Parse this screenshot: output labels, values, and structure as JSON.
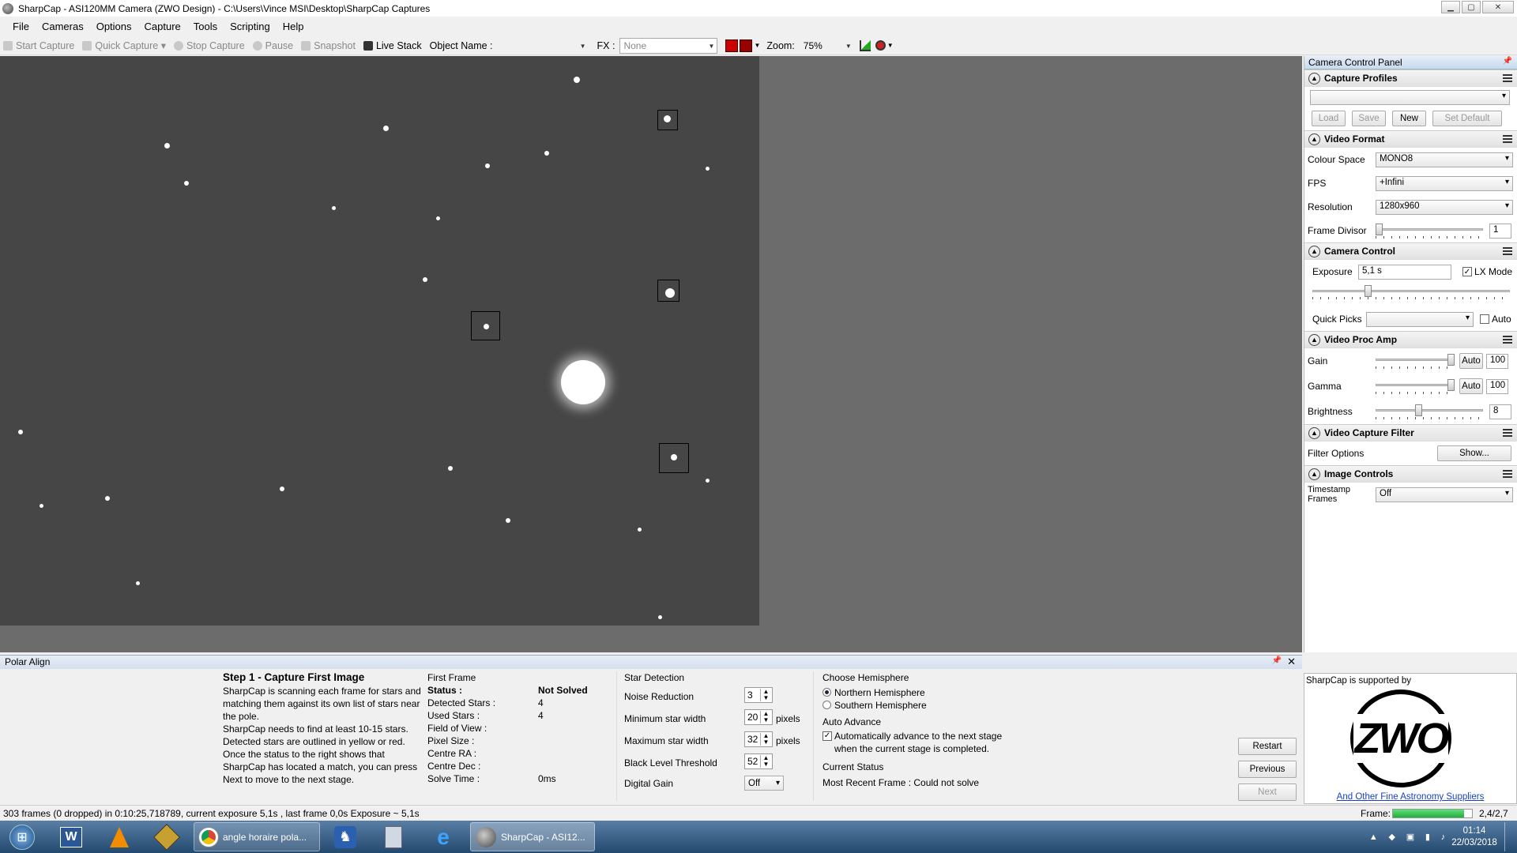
{
  "window": {
    "title": "SharpCap - ASI120MM Camera (ZWO Design) - C:\\Users\\Vince MSI\\Desktop\\SharpCap Captures"
  },
  "menu": [
    "File",
    "Cameras",
    "Options",
    "Capture",
    "Tools",
    "Scripting",
    "Help"
  ],
  "toolbar": {
    "start_capture": "Start Capture",
    "quick_capture": "Quick Capture",
    "stop_capture": "Stop Capture",
    "pause": "Pause",
    "snapshot": "Snapshot",
    "live_stack": "Live Stack",
    "object_name_label": "Object Name :",
    "object_name_value": "",
    "fx_label": "FX :",
    "fx_value": "None",
    "zoom_label": "Zoom:",
    "zoom_value": "75%"
  },
  "ccp": {
    "title": "Camera Control Panel",
    "capture_profiles": {
      "heading": "Capture Profiles",
      "selected": "",
      "load": "Load",
      "save": "Save",
      "new": "New",
      "set_default": "Set Default"
    },
    "video_format": {
      "heading": "Video Format",
      "colour_space_label": "Colour Space",
      "colour_space": "MONO8",
      "fps_label": "FPS",
      "fps": "+Infini",
      "resolution_label": "Resolution",
      "resolution": "1280x960",
      "frame_divisor_label": "Frame Divisor",
      "frame_divisor": "1"
    },
    "camera_control": {
      "heading": "Camera Control",
      "exposure_label": "Exposure",
      "exposure": "5,1 s",
      "lx_mode_label": "LX Mode",
      "lx_mode": true,
      "quick_picks_label": "Quick Picks",
      "quick_picks": "",
      "auto_label": "Auto"
    },
    "video_proc_amp": {
      "heading": "Video Proc Amp",
      "gain_label": "Gain",
      "gain": "100",
      "gamma_label": "Gamma",
      "gamma": "100",
      "brightness_label": "Brightness",
      "brightness": "8",
      "auto_label": "Auto"
    },
    "video_capture_filter": {
      "heading": "Video Capture Filter",
      "filter_options_label": "Filter Options",
      "show": "Show..."
    },
    "image_controls": {
      "heading": "Image Controls",
      "timestamp_label": "Timestamp Frames",
      "timestamp": "Off"
    }
  },
  "polar_align": {
    "title": "Polar Align",
    "step_title": "Step 1 - Capture First Image",
    "step_text": [
      "SharpCap is scanning each frame for stars and",
      "matching them against its own list of stars near",
      "the pole.",
      "SharpCap needs to find at least 10-15 stars.",
      "Detected stars are outlined in yellow or red.",
      "Once the status to the right shows that",
      "SharpCap has located a match, you can press",
      "Next to move to the next stage."
    ],
    "first_frame": {
      "heading": "First Frame",
      "rows": [
        {
          "label": "Status :",
          "value": "Not Solved"
        },
        {
          "label": "Detected Stars :",
          "value": "4"
        },
        {
          "label": "Used Stars :",
          "value": "4"
        },
        {
          "label": "Field of View :",
          "value": ""
        },
        {
          "label": "Pixel Size :",
          "value": ""
        },
        {
          "label": "Centre RA :",
          "value": ""
        },
        {
          "label": "Centre Dec :",
          "value": ""
        },
        {
          "label": "Solve Time :",
          "value": "0ms"
        }
      ]
    },
    "star_detection": {
      "heading": "Star Detection",
      "noise_label": "Noise Reduction",
      "noise": "3",
      "min_label": "Minimum star width",
      "min": "20",
      "max_label": "Maximum star width",
      "max": "32",
      "blt_label": "Black Level Threshold",
      "blt": "52",
      "gain_label": "Digital Gain",
      "gain": "Off",
      "pixels": "pixels"
    },
    "hemisphere": {
      "heading": "Choose Hemisphere",
      "north": "Northern Hemisphere",
      "south": "Southern Hemisphere",
      "selected": "north"
    },
    "auto_advance": {
      "heading": "Auto Advance",
      "line1": "Automatically advance to the next stage",
      "line2": "when the current stage is completed.",
      "checked": true
    },
    "current_status": {
      "heading": "Current Status",
      "text": "Most Recent Frame : Could not solve"
    },
    "buttons": {
      "restart": "Restart",
      "previous": "Previous",
      "next": "Next"
    }
  },
  "sponsor": {
    "text": "SharpCap is supported by",
    "logo": "ZWO",
    "link": "And Other Fine Astronomy Suppliers"
  },
  "statusbar": {
    "text": "303 frames (0 dropped) in 0:10:25,718789, current exposure 5,1s , last frame 0,0s Exposure ~ 5,1s",
    "frame_label": "Frame:",
    "frame_value": "2,4/2,7",
    "frame_progress": 0.9
  },
  "taskbar": {
    "chrome_label": "angle horaire pola...",
    "sharpcap_label": "SharpCap - ASI12...",
    "time": "01:14",
    "date": "22/03/2018"
  },
  "colors": {
    "accent": "#3c7fd1",
    "taskbar": "#2b557f",
    "progress": "#27c24a"
  }
}
